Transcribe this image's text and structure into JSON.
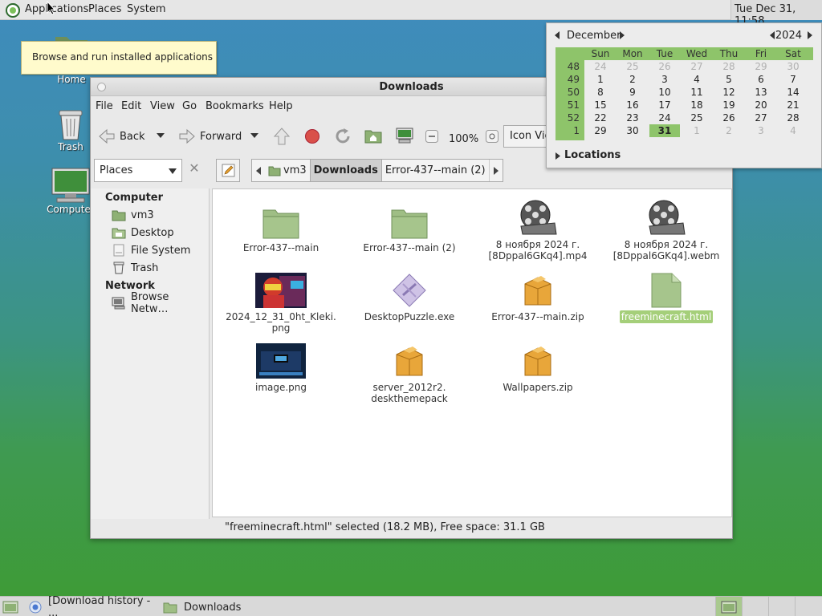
{
  "topbar": {
    "applications": "Applications",
    "places": "Places",
    "system": "System",
    "clock": "Tue Dec 31, 11:58"
  },
  "tooltip": "Browse and run installed applications",
  "desktop": {
    "icons": [
      {
        "label": "vm3's Home",
        "icon": "home-folder-icon"
      },
      {
        "label": "Trash",
        "icon": "trash-icon"
      },
      {
        "label": "Computer",
        "icon": "computer-icon"
      }
    ]
  },
  "window": {
    "title": "Downloads",
    "menu": [
      "File",
      "Edit",
      "View",
      "Go",
      "Bookmarks",
      "Help"
    ],
    "toolbar": {
      "back": "Back",
      "forward": "Forward",
      "zoom": "100%",
      "view_mode": "Icon Vie"
    },
    "places_combo": "Places",
    "breadcrumb": [
      "vm3",
      "Downloads",
      "Error-437--main (2)"
    ],
    "sidebar": {
      "computer_heading": "Computer",
      "computer_items": [
        {
          "label": "vm3",
          "icon": "home-folder-icon"
        },
        {
          "label": "Desktop",
          "icon": "desktop-folder-icon"
        },
        {
          "label": "File System",
          "icon": "drive-icon"
        },
        {
          "label": "Trash",
          "icon": "trash-icon"
        }
      ],
      "network_heading": "Network",
      "network_items": [
        {
          "label": "Browse Netw…",
          "icon": "network-icon"
        }
      ]
    },
    "files": [
      {
        "name": "Error-437--main",
        "type": "folder"
      },
      {
        "name": "Error-437--main (2)",
        "type": "folder"
      },
      {
        "name": "8 ноября 2024 г. [8Dppal6GKq4].mp4",
        "type": "video"
      },
      {
        "name": "8 ноября 2024 г. [8Dppal6GKq4].webm",
        "type": "video"
      },
      {
        "name": "2024_12_31_0ht_Kleki. png",
        "type": "image-thumb"
      },
      {
        "name": "DesktopPuzzle.exe",
        "type": "exe"
      },
      {
        "name": "Error-437--main.zip",
        "type": "archive"
      },
      {
        "name": "freeminecraft.html",
        "type": "html",
        "selected": true
      },
      {
        "name": "image.png",
        "type": "image-thumb2"
      },
      {
        "name": "server_2012r2. deskthemepack",
        "type": "archive"
      },
      {
        "name": "Wallpapers.zip",
        "type": "archive"
      }
    ],
    "status": "\"freeminecraft.html\" selected (18.2 MB), Free space: 31.1 GB"
  },
  "calendar": {
    "month": "December",
    "year": "2024",
    "weekdays": [
      "Sun",
      "Mon",
      "Tue",
      "Wed",
      "Thu",
      "Fri",
      "Sat"
    ],
    "weeks": [
      {
        "num": "48",
        "days": [
          "24",
          "25",
          "26",
          "27",
          "28",
          "29",
          "30"
        ],
        "other": [
          true,
          true,
          true,
          true,
          true,
          true,
          true
        ]
      },
      {
        "num": "49",
        "days": [
          "1",
          "2",
          "3",
          "4",
          "5",
          "6",
          "7"
        ],
        "other": [
          false,
          false,
          false,
          false,
          false,
          false,
          false
        ]
      },
      {
        "num": "50",
        "days": [
          "8",
          "9",
          "10",
          "11",
          "12",
          "13",
          "14"
        ],
        "other": [
          false,
          false,
          false,
          false,
          false,
          false,
          false
        ]
      },
      {
        "num": "51",
        "days": [
          "15",
          "16",
          "17",
          "18",
          "19",
          "20",
          "21"
        ],
        "other": [
          false,
          false,
          false,
          false,
          false,
          false,
          false
        ]
      },
      {
        "num": "52",
        "days": [
          "22",
          "23",
          "24",
          "25",
          "26",
          "27",
          "28"
        ],
        "other": [
          false,
          false,
          false,
          false,
          false,
          false,
          false
        ]
      },
      {
        "num": "1",
        "days": [
          "29",
          "30",
          "31",
          "1",
          "2",
          "3",
          "4"
        ],
        "other": [
          false,
          false,
          false,
          true,
          true,
          true,
          true
        ]
      }
    ],
    "today": "31",
    "locations": "Locations"
  },
  "taskbar": {
    "tasks": [
      "[Download history - ...",
      "Downloads"
    ]
  },
  "colors": {
    "accent": "#8ec46a",
    "selected": "#a5cf7a",
    "folder": "#9fbe85"
  }
}
